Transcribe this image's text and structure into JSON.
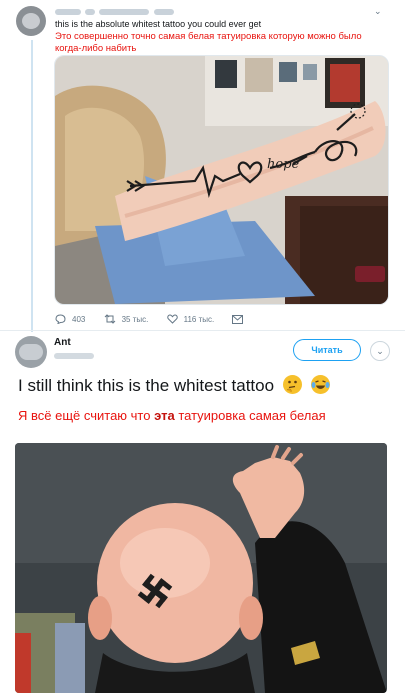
{
  "tweet1": {
    "name_blurred": "kassie",
    "handle_blurred": "@lizzyruchens",
    "time_blurred": "20 июл.",
    "text_en": "this is the absolute whitest tattoo you could ever get",
    "text_ru": "Это совершенно точно самая белая татуировка которую можно было когда-либо набить",
    "image_tattoo_word": "hope",
    "stats": {
      "replies": "403",
      "retweets": "35 тыс.",
      "likes": "116 тыс."
    }
  },
  "tweet2": {
    "name": "Ant",
    "handle_blurred": "@348Ant",
    "follow_label": "Читать",
    "text_en": "I still think this is the whitest tattoo",
    "text_ru_before": "Я всё ещё считаю что ",
    "text_ru_bold": "эта",
    "text_ru_after": " татуировка самая белая",
    "emojis": [
      "thinking-face-emoji",
      "tears-of-joy-emoji"
    ]
  },
  "colors": {
    "twitter_blue": "#1da1f2",
    "translation_red": "#e8140f",
    "muted": "#657786"
  }
}
